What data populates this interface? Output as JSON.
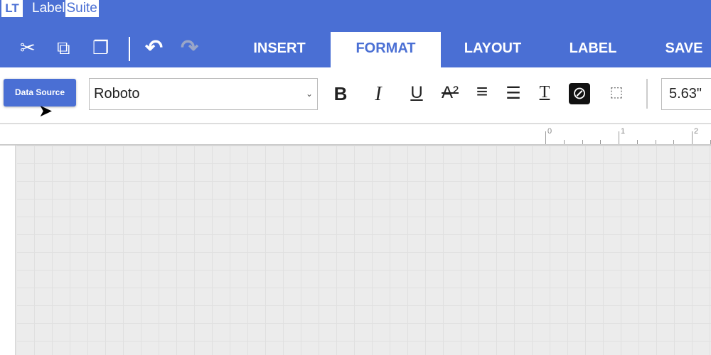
{
  "app": {
    "logo_mark": "LT",
    "name_part1": "Label",
    "name_part2": "Suite"
  },
  "quick_tools": [
    {
      "icon": "scissors-icon",
      "glyph": "✂"
    },
    {
      "icon": "copy-icon",
      "glyph": "⧉"
    },
    {
      "icon": "paste-icon",
      "glyph": "❐"
    },
    {
      "icon": "undo-icon",
      "glyph": "↶"
    },
    {
      "icon": "redo-icon",
      "glyph": "↷"
    }
  ],
  "tabs": [
    {
      "label": "INSERT"
    },
    {
      "label": "FORMAT",
      "active": true
    },
    {
      "label": "LAYOUT"
    },
    {
      "label": "LABEL"
    },
    {
      "label": "SAVE"
    }
  ],
  "toolbar": {
    "data_source": "Data Source",
    "font_value": "Roboto",
    "size_value": "5.63\"",
    "tools": [
      {
        "name": "bold",
        "glyph": "B"
      },
      {
        "name": "italic",
        "glyph": "I"
      },
      {
        "name": "underline",
        "glyph": "U"
      },
      {
        "name": "superscript",
        "glyph": "A²"
      },
      {
        "name": "align",
        "glyph": "≡"
      },
      {
        "name": "line-spacing",
        "glyph": "☰"
      },
      {
        "name": "text-direction",
        "glyph": "T"
      },
      {
        "name": "fill-color",
        "glyph": "⊘"
      },
      {
        "name": "resize",
        "glyph": "⬚"
      }
    ]
  },
  "ruler": {
    "labels": [
      "0",
      "1",
      "2"
    ]
  },
  "colors": {
    "brand": "#4a6fd4"
  }
}
